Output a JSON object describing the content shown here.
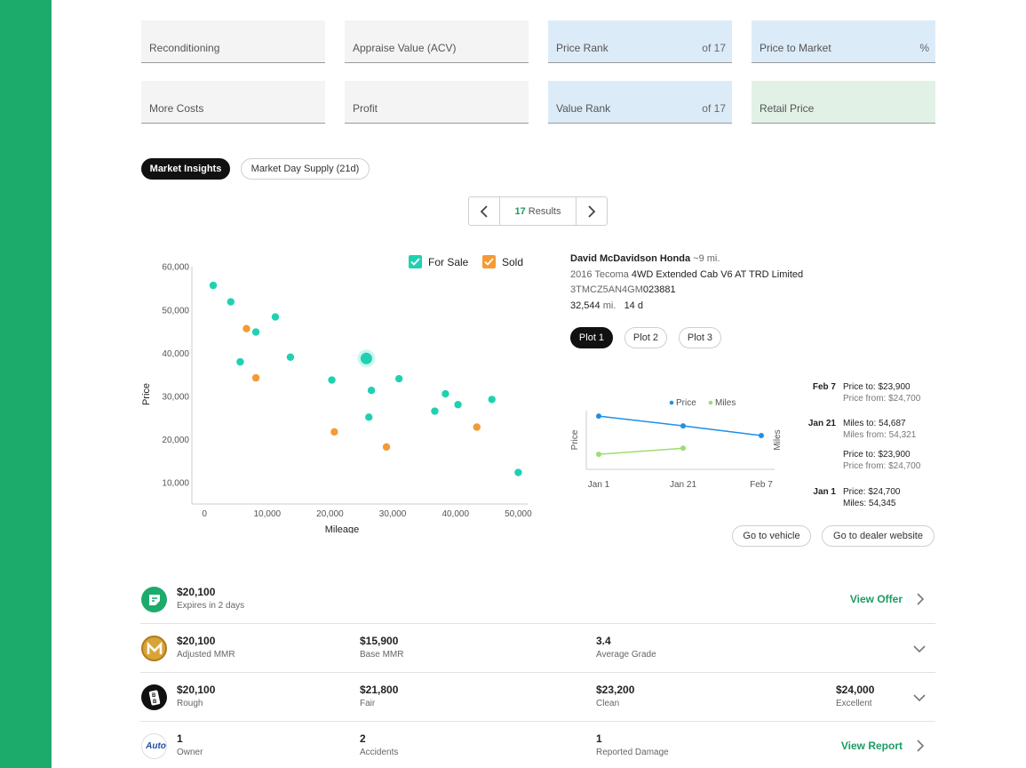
{
  "fields": {
    "reconditioning": "Reconditioning",
    "appraise_value": "Appraise Value (ACV)",
    "price_rank": "Price Rank",
    "price_rank_suffix": "of 17",
    "price_to_market": "Price to Market",
    "price_to_market_suffix": "%",
    "more_costs": "More Costs",
    "profit": "Profit",
    "value_rank": "Value Rank",
    "value_rank_suffix": "of 17",
    "retail_price": "Retail Price"
  },
  "tabs": {
    "market_insights": "Market Insights",
    "market_day_supply": "Market Day Supply (21d)"
  },
  "pager": {
    "count": "17",
    "label": "Results"
  },
  "legend": {
    "for_sale": "For Sale",
    "sold": "Sold"
  },
  "colors": {
    "for_sale": "#1fd1b2",
    "sold": "#f59a35",
    "brand_green": "#1dab6c",
    "price_line": "#1e90e8",
    "miles_line": "#9ddc73"
  },
  "chart_data": [
    {
      "type": "scatter",
      "xlabel": "Mileage",
      "ylabel": "Price",
      "xlim": [
        -2000,
        51500
      ],
      "ylim": [
        5000,
        62000
      ],
      "xticks": [
        0,
        10000,
        20000,
        30000,
        40000,
        50000
      ],
      "xtick_labels": [
        "0",
        "10,000",
        "20,000",
        "30,000",
        "40,000",
        "50,000"
      ],
      "yticks": [
        10000,
        20000,
        30000,
        40000,
        50000,
        60000
      ],
      "ytick_labels": [
        "10,000",
        "20,000",
        "30,000",
        "40,000",
        "50,000",
        "60,000"
      ],
      "legend_position": "top-right",
      "selected_point": {
        "x": 25800,
        "y": 38700
      },
      "series": [
        {
          "name": "For Sale",
          "points": [
            {
              "x": 1400,
              "y": 55600
            },
            {
              "x": 4200,
              "y": 51800
            },
            {
              "x": 8200,
              "y": 44800
            },
            {
              "x": 5700,
              "y": 37900
            },
            {
              "x": 11300,
              "y": 48300
            },
            {
              "x": 13700,
              "y": 39000
            },
            {
              "x": 20300,
              "y": 33700
            },
            {
              "x": 26600,
              "y": 31300
            },
            {
              "x": 26200,
              "y": 25100
            },
            {
              "x": 31000,
              "y": 34000
            },
            {
              "x": 36700,
              "y": 26500
            },
            {
              "x": 38400,
              "y": 30500
            },
            {
              "x": 40400,
              "y": 28000
            },
            {
              "x": 45800,
              "y": 29200
            },
            {
              "x": 50000,
              "y": 12300
            }
          ]
        },
        {
          "name": "Sold",
          "points": [
            {
              "x": 6700,
              "y": 45600
            },
            {
              "x": 8200,
              "y": 34200
            },
            {
              "x": 20700,
              "y": 21700
            },
            {
              "x": 29000,
              "y": 18200
            },
            {
              "x": 43400,
              "y": 22800
            }
          ]
        }
      ]
    },
    {
      "type": "line",
      "xlabel": "",
      "ylabel": "Price",
      "y2label": "Miles",
      "categories": [
        "Jan 1",
        "Jan 21",
        "Feb 7"
      ],
      "legend_position": "top",
      "series": [
        {
          "name": "Price",
          "values": [
            24700,
            23900,
            23900
          ]
        },
        {
          "name": "Miles",
          "values": [
            54345,
            54687,
            null
          ]
        }
      ]
    }
  ],
  "dealer": {
    "name": "David McDavidson Honda",
    "distance": "~9 mi.",
    "year_make": "2016 Tecoma",
    "trim": "4WD Extended Cab V6 AT TRD Limited",
    "vin_prefix": "3TMCZ5AN4GM",
    "vin_suffix": "023881",
    "miles": "32,544",
    "miles_unit": "mi.",
    "days": "14 d"
  },
  "plots": [
    "Plot 1",
    "Plot 2",
    "Plot 3"
  ],
  "history": [
    {
      "date": "Feb 7",
      "line1": "Price to: $23,900",
      "line2": "Price from: $24,700"
    },
    {
      "date": "Jan 21",
      "line1": "Miles to: 54,687",
      "line2": "Miles from: 54,321"
    },
    {
      "date": "",
      "line1": "Price to: $23,900",
      "line2": "Price from: $24,700"
    },
    {
      "date": "Jan 1",
      "line1": "Price: $24,700",
      "line2": "Miles: 54,345"
    }
  ],
  "actions": {
    "go_to_vehicle": "Go to vehicle",
    "go_to_dealer": "Go to dealer website"
  },
  "rows": [
    {
      "cells": [
        {
          "value": "$20,100",
          "label": "Expires in 2 days"
        }
      ],
      "action": "View Offer"
    },
    {
      "cells": [
        {
          "value": "$20,100",
          "label": "Adjusted MMR"
        },
        {
          "value": "$15,900",
          "label": "Base MMR"
        },
        {
          "value": "3.4",
          "label": "Average Grade"
        }
      ]
    },
    {
      "cells": [
        {
          "value": "$20,100",
          "label": "Rough"
        },
        {
          "value": "$21,800",
          "label": "Fair"
        },
        {
          "value": "$23,200",
          "label": "Clean"
        },
        {
          "value": "$24,000",
          "label": "Excellent"
        }
      ]
    },
    {
      "logo_text": "Auto",
      "cells": [
        {
          "value": "1",
          "label": "Owner"
        },
        {
          "value": "2",
          "label": "Accidents"
        },
        {
          "value": "1",
          "label": "Reported Damage"
        }
      ],
      "action": "View Report"
    }
  ]
}
